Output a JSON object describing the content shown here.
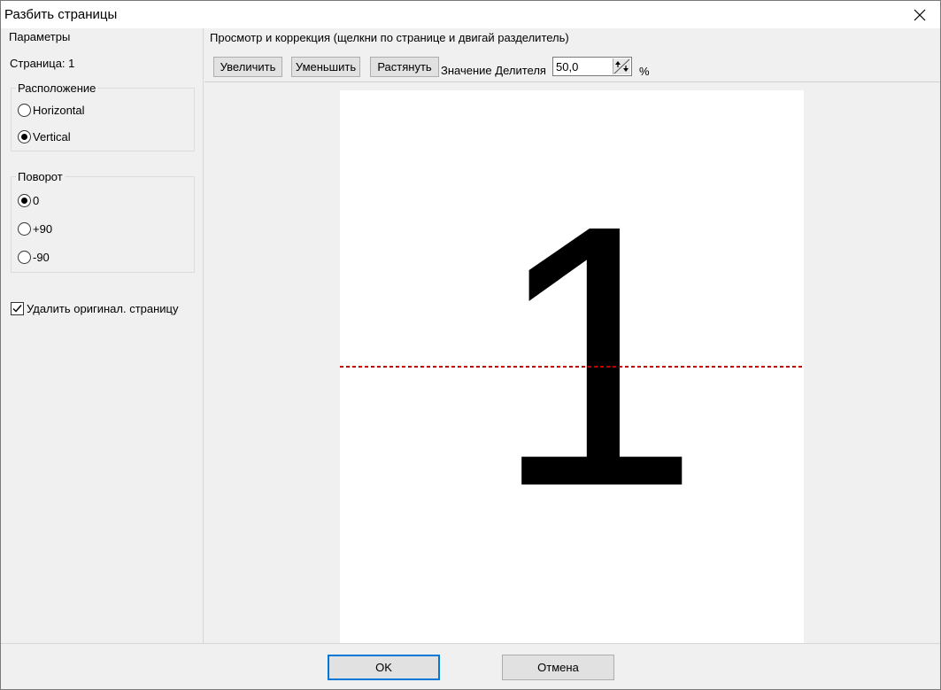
{
  "window": {
    "title": "Разбить страницы",
    "close_glyph": "✕"
  },
  "left": {
    "params_label": "Параметры",
    "page_label": "Страница: 1",
    "layout": {
      "label": "Расположение",
      "options": [
        {
          "label": "Horizontal",
          "checked": false
        },
        {
          "label": "Vertical",
          "checked": true
        }
      ]
    },
    "rotation": {
      "label": "Поворот",
      "options": [
        {
          "label": "0",
          "checked": true
        },
        {
          "label": "+90",
          "checked": false
        },
        {
          "label": "-90",
          "checked": false
        }
      ]
    },
    "delete_original": {
      "label": "Удалить оригинал. страницу",
      "checked": true
    }
  },
  "preview": {
    "header": "Просмотр и коррекция (щелкни по странице и двигай разделитель)",
    "zoom_in_label": "Увеличить",
    "zoom_out_label": "Уменьшить",
    "stretch_label": "Растянуть",
    "divider_label": "Значение Делителя",
    "divider_value": "50,0",
    "percent_label": "%",
    "page_digit": "1",
    "divider_fraction": 0.5,
    "divider_color": "#c00000"
  },
  "footer": {
    "ok_label": "OK",
    "cancel_label": "Отмена"
  },
  "colors": {
    "ok_border": "#0078d7"
  }
}
